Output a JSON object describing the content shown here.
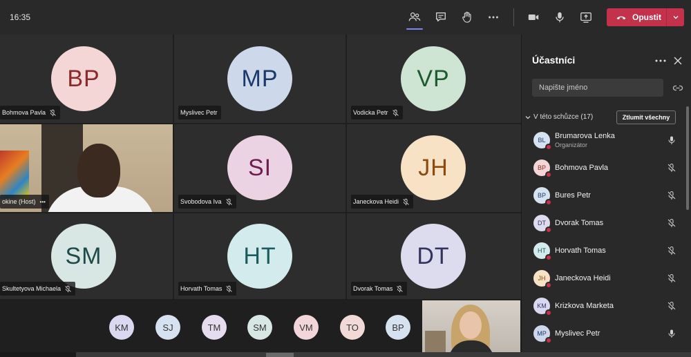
{
  "topbar": {
    "time": "16:35",
    "leave_label": "Opustit"
  },
  "tiles": [
    {
      "initials": "BP",
      "name": "Bohmova Pavla",
      "bg": "#f4d6d6",
      "fg": "#8b2a2a",
      "muted": true
    },
    {
      "initials": "MP",
      "name": "Myslivec Petr",
      "bg": "#cdd8ea",
      "fg": "#1b3a6b",
      "muted": false
    },
    {
      "initials": "VP",
      "name": "Vodicka Petr",
      "bg": "#cfe5d3",
      "fg": "#1e5a2f",
      "muted": true
    },
    {
      "initials": "",
      "name": "okine (Host)",
      "video": true,
      "more": "•••"
    },
    {
      "initials": "SI",
      "name": "Svobodova Iva",
      "bg": "#ecd3e3",
      "fg": "#6b1f4f",
      "muted": true
    },
    {
      "initials": "JH",
      "name": "Janeckova Heidi",
      "bg": "#f7e2c6",
      "fg": "#8a4a10",
      "muted": true
    },
    {
      "initials": "SM",
      "name": "Skultetyova Michaela",
      "bg": "#d8e6e4",
      "fg": "#1e4a48",
      "muted": true
    },
    {
      "initials": "HT",
      "name": "Horvath Tomas",
      "bg": "#d3ebec",
      "fg": "#1c5a5e",
      "muted": true
    },
    {
      "initials": "DT",
      "name": "Dvorak Tomas",
      "bg": "#dcdcee",
      "fg": "#33335e",
      "muted": true
    }
  ],
  "strip": [
    {
      "initials": "KM",
      "bg": "#dad8f0"
    },
    {
      "initials": "SJ",
      "bg": "#d6e2f0"
    },
    {
      "initials": "TM",
      "bg": "#e6dcef"
    },
    {
      "initials": "SM",
      "bg": "#d7e7e3"
    },
    {
      "initials": "VM",
      "bg": "#f3d6da"
    },
    {
      "initials": "TO",
      "bg": "#f0d9d7"
    },
    {
      "initials": "BP",
      "bg": "#d6e2f0"
    }
  ],
  "panel": {
    "title": "Účastníci",
    "search_placeholder": "Napište jméno",
    "section_label": "V této schůzce (17)",
    "mute_all_label": "Ztlumit všechny",
    "participants": [
      {
        "initials": "BL",
        "name": "Brumarova Lenka",
        "role": "Organizátor",
        "bg": "#d6e2f0",
        "fg": "#1b3a6b",
        "mic": "on"
      },
      {
        "initials": "BP",
        "name": "Bohmova Pavla",
        "bg": "#f4d6d6",
        "fg": "#8b2a2a",
        "mic": "off"
      },
      {
        "initials": "BP",
        "name": "Bures Petr",
        "bg": "#d6e2f0",
        "fg": "#1b3a6b",
        "mic": "off"
      },
      {
        "initials": "DT",
        "name": "Dvorak Tomas",
        "bg": "#dcdcee",
        "fg": "#33335e",
        "mic": "off"
      },
      {
        "initials": "HT",
        "name": "Horvath Tomas",
        "bg": "#d3ebec",
        "fg": "#1c5a5e",
        "mic": "off"
      },
      {
        "initials": "JH",
        "name": "Janeckova Heidi",
        "bg": "#f7e2c6",
        "fg": "#8a4a10",
        "mic": "off"
      },
      {
        "initials": "KM",
        "name": "Krizkova Marketa",
        "bg": "#dad8f0",
        "fg": "#33335e",
        "mic": "off"
      },
      {
        "initials": "MP",
        "name": "Myslivec Petr",
        "bg": "#cdd8ea",
        "fg": "#1b3a6b",
        "mic": "on"
      }
    ]
  },
  "colors": {
    "accent": "#7f85f5",
    "leave": "#c4314b"
  }
}
